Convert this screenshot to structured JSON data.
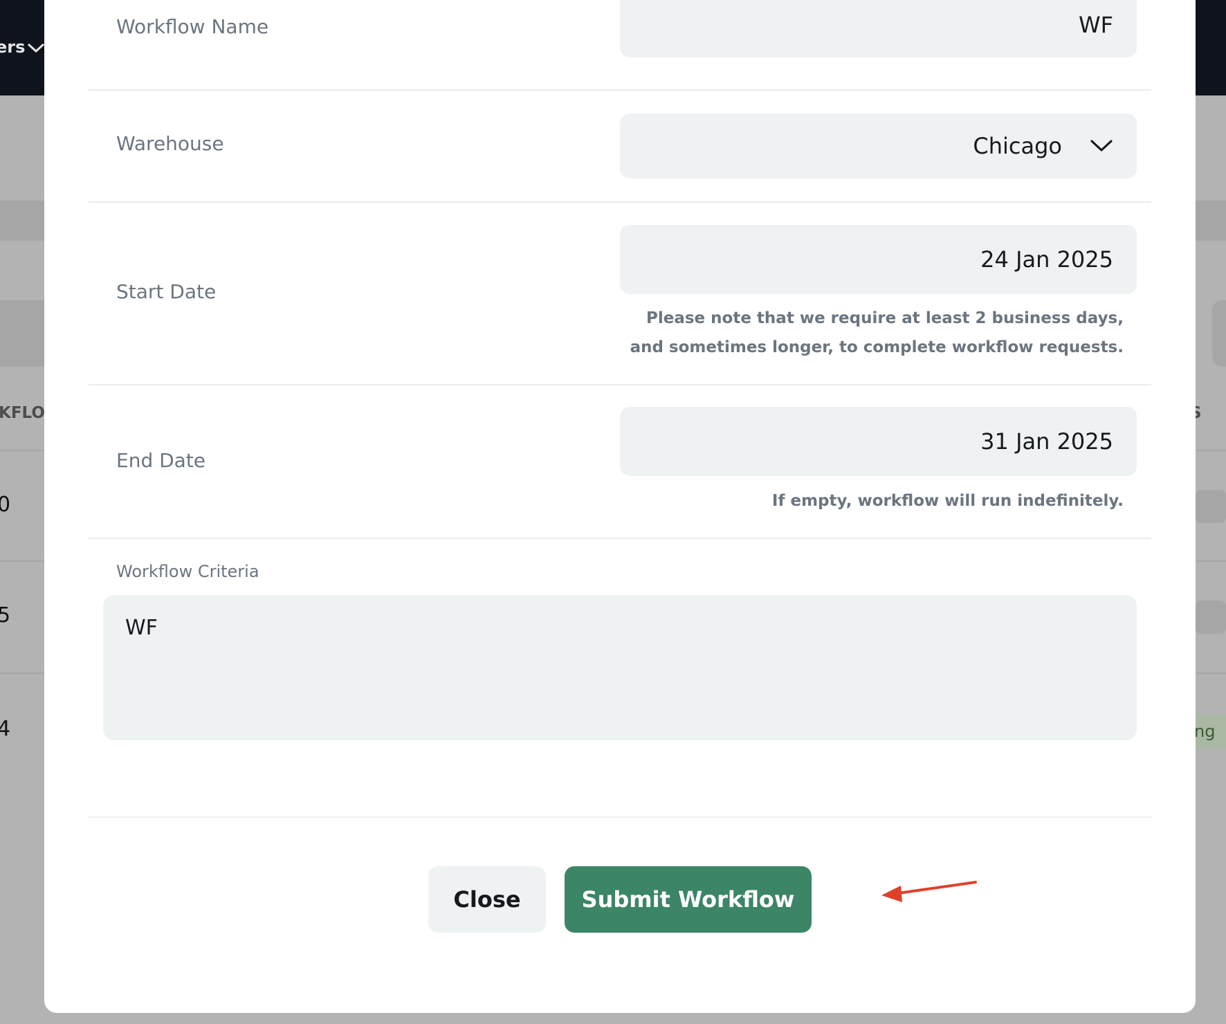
{
  "background": {
    "topbar_label": "ers",
    "column_header_left": "KFLOV",
    "column_header_right": "S",
    "row_values": [
      "0",
      "5",
      "4"
    ],
    "status_fragment": "ng"
  },
  "form": {
    "workflow_name": {
      "label": "Workflow Name",
      "value": "WF"
    },
    "warehouse": {
      "label": "Warehouse",
      "value": "Chicago"
    },
    "start_date": {
      "label": "Start Date",
      "value": "24 Jan 2025",
      "note": "Please note that we require at least 2 business days, and sometimes longer, to complete workflow requests."
    },
    "end_date": {
      "label": "End Date",
      "value": "31 Jan 2025",
      "note": "If empty, workflow will run indefinitely."
    },
    "criteria": {
      "label": "Workflow Criteria",
      "value": "WF"
    }
  },
  "actions": {
    "close_label": "Close",
    "submit_label": "Submit Workflow"
  },
  "colors": {
    "primary": "#3c8566",
    "annotation_arrow": "#e0402a"
  }
}
